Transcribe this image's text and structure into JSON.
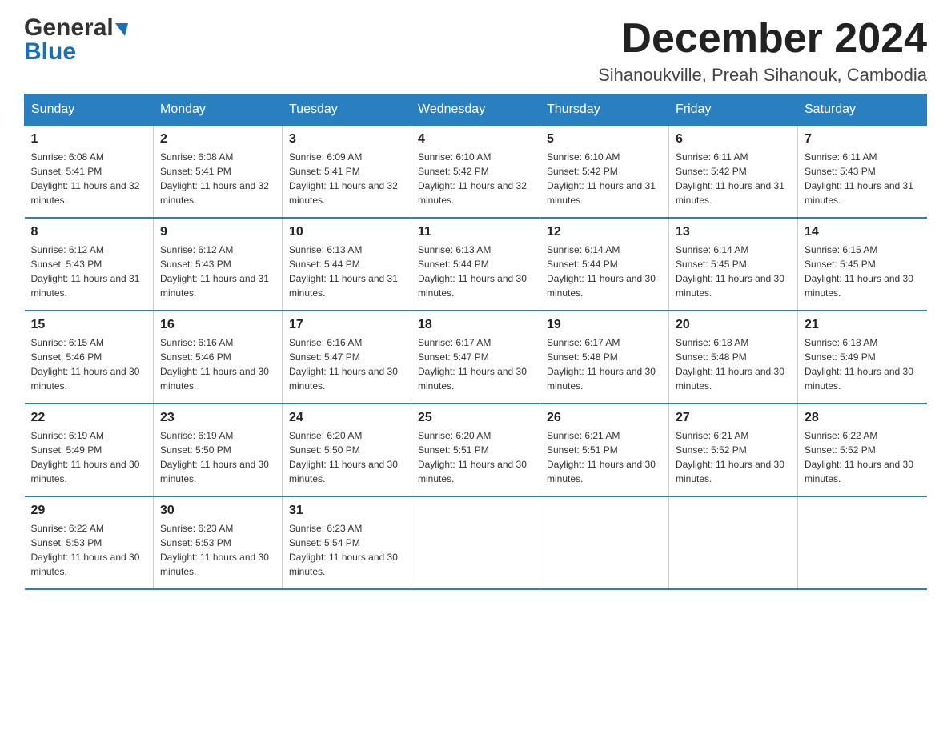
{
  "header": {
    "logo_general": "General",
    "logo_blue": "Blue",
    "month_title": "December 2024",
    "location": "Sihanoukville, Preah Sihanouk, Cambodia"
  },
  "weekdays": [
    "Sunday",
    "Monday",
    "Tuesday",
    "Wednesday",
    "Thursday",
    "Friday",
    "Saturday"
  ],
  "weeks": [
    [
      {
        "day": "1",
        "sunrise": "6:08 AM",
        "sunset": "5:41 PM",
        "daylight": "11 hours and 32 minutes."
      },
      {
        "day": "2",
        "sunrise": "6:08 AM",
        "sunset": "5:41 PM",
        "daylight": "11 hours and 32 minutes."
      },
      {
        "day": "3",
        "sunrise": "6:09 AM",
        "sunset": "5:41 PM",
        "daylight": "11 hours and 32 minutes."
      },
      {
        "day": "4",
        "sunrise": "6:10 AM",
        "sunset": "5:42 PM",
        "daylight": "11 hours and 32 minutes."
      },
      {
        "day": "5",
        "sunrise": "6:10 AM",
        "sunset": "5:42 PM",
        "daylight": "11 hours and 31 minutes."
      },
      {
        "day": "6",
        "sunrise": "6:11 AM",
        "sunset": "5:42 PM",
        "daylight": "11 hours and 31 minutes."
      },
      {
        "day": "7",
        "sunrise": "6:11 AM",
        "sunset": "5:43 PM",
        "daylight": "11 hours and 31 minutes."
      }
    ],
    [
      {
        "day": "8",
        "sunrise": "6:12 AM",
        "sunset": "5:43 PM",
        "daylight": "11 hours and 31 minutes."
      },
      {
        "day": "9",
        "sunrise": "6:12 AM",
        "sunset": "5:43 PM",
        "daylight": "11 hours and 31 minutes."
      },
      {
        "day": "10",
        "sunrise": "6:13 AM",
        "sunset": "5:44 PM",
        "daylight": "11 hours and 31 minutes."
      },
      {
        "day": "11",
        "sunrise": "6:13 AM",
        "sunset": "5:44 PM",
        "daylight": "11 hours and 30 minutes."
      },
      {
        "day": "12",
        "sunrise": "6:14 AM",
        "sunset": "5:44 PM",
        "daylight": "11 hours and 30 minutes."
      },
      {
        "day": "13",
        "sunrise": "6:14 AM",
        "sunset": "5:45 PM",
        "daylight": "11 hours and 30 minutes."
      },
      {
        "day": "14",
        "sunrise": "6:15 AM",
        "sunset": "5:45 PM",
        "daylight": "11 hours and 30 minutes."
      }
    ],
    [
      {
        "day": "15",
        "sunrise": "6:15 AM",
        "sunset": "5:46 PM",
        "daylight": "11 hours and 30 minutes."
      },
      {
        "day": "16",
        "sunrise": "6:16 AM",
        "sunset": "5:46 PM",
        "daylight": "11 hours and 30 minutes."
      },
      {
        "day": "17",
        "sunrise": "6:16 AM",
        "sunset": "5:47 PM",
        "daylight": "11 hours and 30 minutes."
      },
      {
        "day": "18",
        "sunrise": "6:17 AM",
        "sunset": "5:47 PM",
        "daylight": "11 hours and 30 minutes."
      },
      {
        "day": "19",
        "sunrise": "6:17 AM",
        "sunset": "5:48 PM",
        "daylight": "11 hours and 30 minutes."
      },
      {
        "day": "20",
        "sunrise": "6:18 AM",
        "sunset": "5:48 PM",
        "daylight": "11 hours and 30 minutes."
      },
      {
        "day": "21",
        "sunrise": "6:18 AM",
        "sunset": "5:49 PM",
        "daylight": "11 hours and 30 minutes."
      }
    ],
    [
      {
        "day": "22",
        "sunrise": "6:19 AM",
        "sunset": "5:49 PM",
        "daylight": "11 hours and 30 minutes."
      },
      {
        "day": "23",
        "sunrise": "6:19 AM",
        "sunset": "5:50 PM",
        "daylight": "11 hours and 30 minutes."
      },
      {
        "day": "24",
        "sunrise": "6:20 AM",
        "sunset": "5:50 PM",
        "daylight": "11 hours and 30 minutes."
      },
      {
        "day": "25",
        "sunrise": "6:20 AM",
        "sunset": "5:51 PM",
        "daylight": "11 hours and 30 minutes."
      },
      {
        "day": "26",
        "sunrise": "6:21 AM",
        "sunset": "5:51 PM",
        "daylight": "11 hours and 30 minutes."
      },
      {
        "day": "27",
        "sunrise": "6:21 AM",
        "sunset": "5:52 PM",
        "daylight": "11 hours and 30 minutes."
      },
      {
        "day": "28",
        "sunrise": "6:22 AM",
        "sunset": "5:52 PM",
        "daylight": "11 hours and 30 minutes."
      }
    ],
    [
      {
        "day": "29",
        "sunrise": "6:22 AM",
        "sunset": "5:53 PM",
        "daylight": "11 hours and 30 minutes."
      },
      {
        "day": "30",
        "sunrise": "6:23 AM",
        "sunset": "5:53 PM",
        "daylight": "11 hours and 30 minutes."
      },
      {
        "day": "31",
        "sunrise": "6:23 AM",
        "sunset": "5:54 PM",
        "daylight": "11 hours and 30 minutes."
      },
      null,
      null,
      null,
      null
    ]
  ]
}
